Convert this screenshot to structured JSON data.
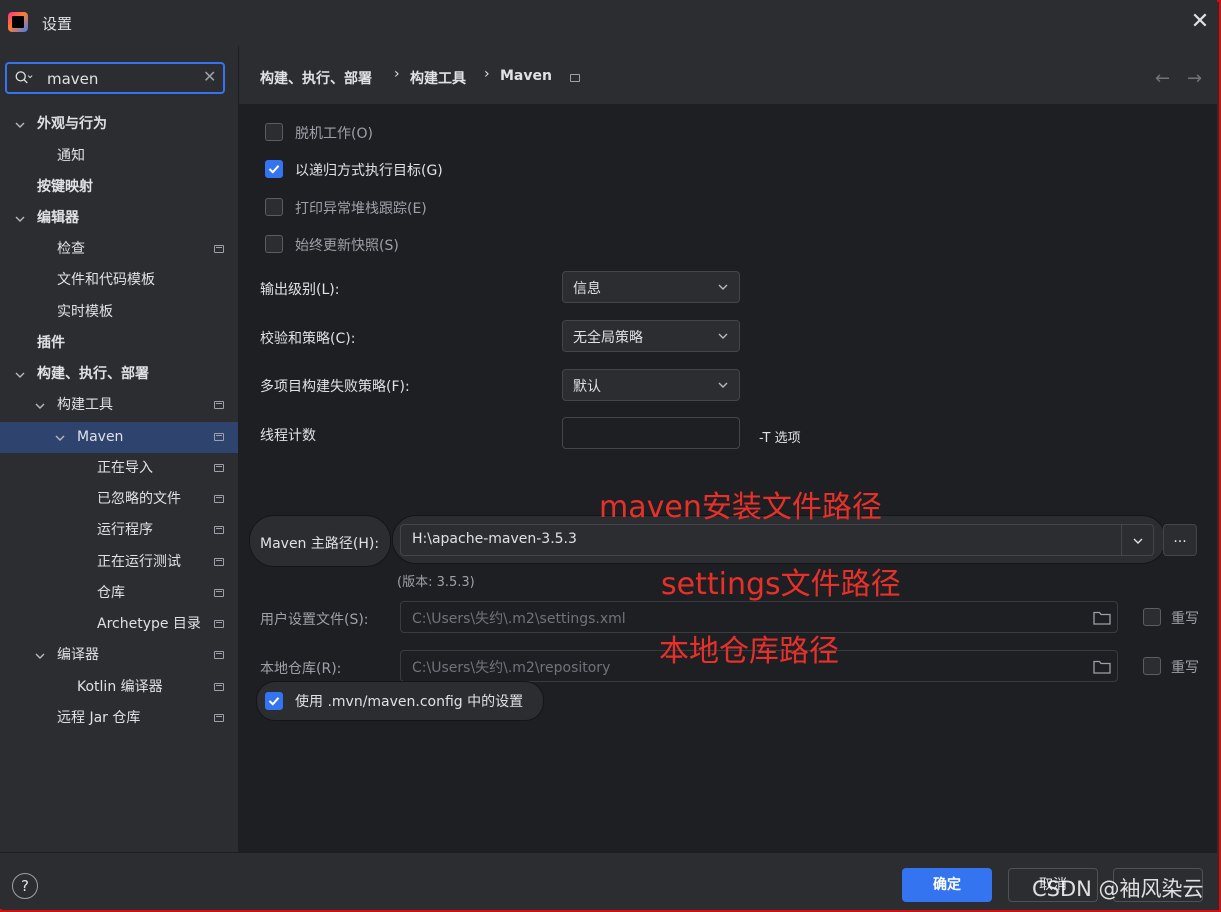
{
  "window": {
    "title": "设置",
    "close_glyph": "✕"
  },
  "search": {
    "value": "maven",
    "clear_glyph": "✕"
  },
  "tree": {
    "appearance": "外观与行为",
    "notifications": "通知",
    "keymap": "按键映射",
    "editor": "编辑器",
    "inspections": "检查",
    "file_templates": "文件和代码模板",
    "live_templates": "实时模板",
    "plugins": "插件",
    "build_exec_deploy": "构建、执行、部署",
    "build_tools": "构建工具",
    "maven": "Maven",
    "importing": "正在导入",
    "ignored_files": "已忽略的文件",
    "runner": "运行程序",
    "running_tests": "正在运行测试",
    "repositories": "仓库",
    "archetype": "Archetype 目录",
    "compiler": "编译器",
    "kotlin_compiler": "Kotlin 编译器",
    "remote_jar": "远程 Jar 仓库"
  },
  "breadcrumb": {
    "part1": "构建、执行、部署",
    "part2": "构建工具",
    "part3": "Maven",
    "sep": "›"
  },
  "nav": {
    "back": "←",
    "forward": "→"
  },
  "options": {
    "offline": "脱机工作(O)",
    "recursive": "以递归方式执行目标(G)",
    "print_stack": "打印异常堆栈跟踪(E)",
    "always_update": "始终更新快照(S)"
  },
  "fields": {
    "output_level_label": "输出级别(L):",
    "output_level_value": "信息",
    "checksum_label": "校验和策略(C):",
    "checksum_value": "无全局策略",
    "multiproject_label": "多项目构建失败策略(F):",
    "multiproject_value": "默认",
    "thread_label": "线程计数",
    "thread_hint": "-T 选项",
    "maven_home_label": "Maven 主路径(H):",
    "maven_home_value": "H:\\apache-maven-3.5.3",
    "more": "...",
    "version": "(版本: 3.5.3)",
    "user_settings_label": "用户设置文件(S):",
    "user_settings_value": "C:\\Users\\失约\\.m2\\settings.xml",
    "override": "重写",
    "local_repo_label": "本地仓库(R):",
    "local_repo_value": "C:\\Users\\失约\\.m2\\repository",
    "use_mvn_config": "使用 .mvn/maven.config 中的设置"
  },
  "annotations": {
    "maven_path": "maven安装文件路径",
    "settings_path": "settings文件路径",
    "local_repo_path": "本地仓库路径"
  },
  "footer": {
    "help": "?",
    "ok": "确定",
    "cancel": "取消"
  },
  "watermark": "CSDN @袖风染云",
  "colors": {
    "accent": "#3574f0",
    "annotation": "#e8302a",
    "selection": "#2e436e",
    "frame": "#d01010"
  }
}
